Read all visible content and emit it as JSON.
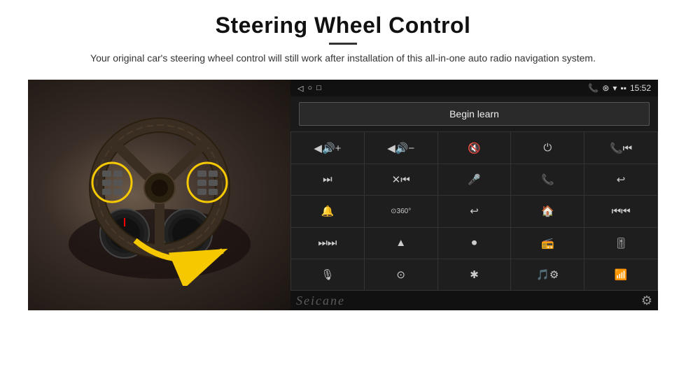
{
  "page": {
    "title": "Steering Wheel Control",
    "divider": true,
    "subtitle": "Your original car's steering wheel control will still work after installation of this all-in-one auto radio navigation system."
  },
  "android_ui": {
    "status_bar": {
      "nav_back": "◁",
      "nav_home": "○",
      "nav_square": "□",
      "battery_signal": "▪▪",
      "phone_icon": "📞",
      "location_icon": "⊛",
      "wifi_icon": "▾",
      "time": "15:52"
    },
    "begin_learn_label": "Begin learn",
    "controls": [
      {
        "icon": "🔊+",
        "label": "vol-up"
      },
      {
        "icon": "🔊-",
        "label": "vol-down"
      },
      {
        "icon": "🔇",
        "label": "mute"
      },
      {
        "icon": "⏻",
        "label": "power"
      },
      {
        "icon": "📞⏮",
        "label": "phone-prev"
      },
      {
        "icon": "⏭",
        "label": "next-track"
      },
      {
        "icon": "⏮✕",
        "label": "prev-cancel"
      },
      {
        "icon": "🎤",
        "label": "microphone"
      },
      {
        "icon": "📞",
        "label": "phone"
      },
      {
        "icon": "↩",
        "label": "hang-up"
      },
      {
        "icon": "🔔",
        "label": "horn"
      },
      {
        "icon": "360",
        "label": "360-cam"
      },
      {
        "icon": "↩",
        "label": "back"
      },
      {
        "icon": "🏠",
        "label": "home"
      },
      {
        "icon": "⏮⏮",
        "label": "rewind"
      },
      {
        "icon": "⏭⏭",
        "label": "fast-forward"
      },
      {
        "icon": "▲",
        "label": "navigate"
      },
      {
        "icon": "⏺",
        "label": "source"
      },
      {
        "icon": "📻",
        "label": "radio"
      },
      {
        "icon": "🎚",
        "label": "equalizer"
      },
      {
        "icon": "🎤",
        "label": "mic2"
      },
      {
        "icon": "⊙",
        "label": "circle-menu"
      },
      {
        "icon": "✱",
        "label": "bluetooth"
      },
      {
        "icon": "🎵",
        "label": "music-settings"
      },
      {
        "icon": "📶",
        "label": "signal"
      }
    ],
    "watermark": "Seicane",
    "gear_icon": "⚙"
  }
}
